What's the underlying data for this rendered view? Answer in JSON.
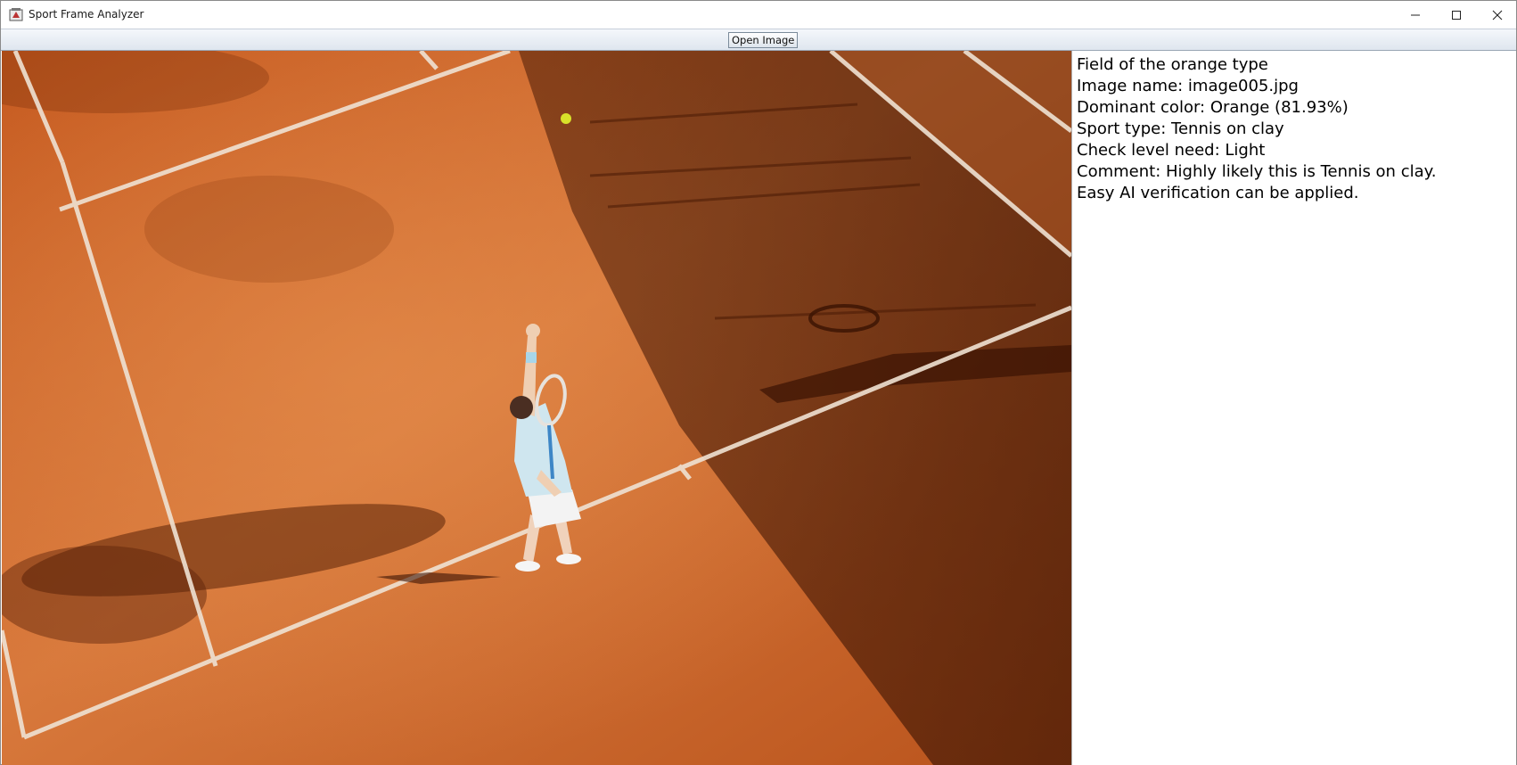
{
  "window": {
    "title": "Sport Frame Analyzer",
    "controls": {
      "minimize": "minimize-icon",
      "maximize": "maximize-icon",
      "close": "close-icon"
    }
  },
  "toolbar": {
    "open_label": "Open Image"
  },
  "image": {
    "description_icon": "tennis-court-photo"
  },
  "info": {
    "lines": [
      "Field of the orange type",
      "Image name: image005.jpg",
      "Dominant color: Orange (81.93%)",
      "Sport type: Tennis on clay",
      "Check level need: Light",
      "Comment: Highly likely this is Tennis on clay.",
      "Easy AI verification can be applied."
    ]
  },
  "colors": {
    "clay": "#c65e24",
    "clay_light": "#d9773a",
    "shadow": "#5a2308",
    "court_line": "#f2e6d8"
  }
}
